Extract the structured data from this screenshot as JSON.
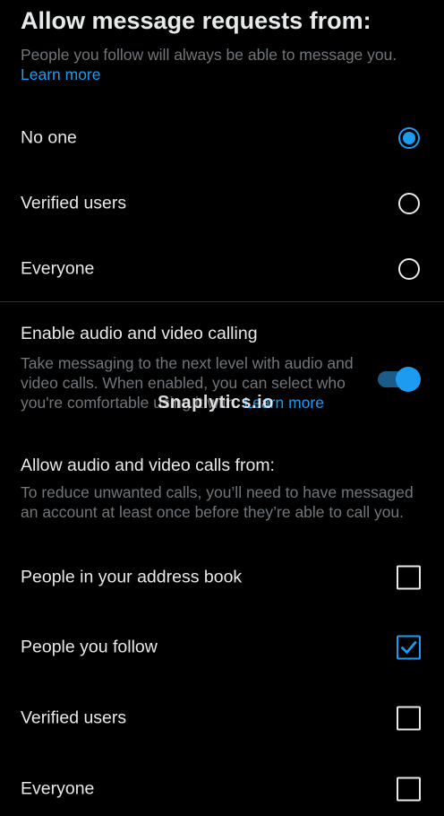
{
  "message_requests": {
    "title": "Allow message requests from:",
    "description": "People you follow will always be able to message you.",
    "learn_more": "Learn more",
    "options": [
      {
        "label": "No one",
        "selected": true
      },
      {
        "label": "Verified users",
        "selected": false
      },
      {
        "label": "Everyone",
        "selected": false
      }
    ]
  },
  "calling": {
    "title": "Enable audio and video calling",
    "description": "Take messaging to the next level with audio and video calls. When enabled, you can select who you're comfortable using it with.",
    "learn_more": "Learn more",
    "enabled": true
  },
  "calls_from": {
    "title": "Allow audio and video calls from:",
    "description": "To reduce unwanted calls, you’ll need to have messaged an account at least once before they’re able to call you.",
    "options": [
      {
        "label": "People in your address book",
        "checked": false
      },
      {
        "label": "People you follow",
        "checked": true
      },
      {
        "label": "Verified users",
        "checked": false
      },
      {
        "label": "Everyone",
        "checked": false
      }
    ]
  },
  "watermark": "Snaplytics.io",
  "colors": {
    "accent": "#1d9bf0",
    "background": "#000000",
    "text": "#e7e9ea",
    "secondary_text": "#71767b"
  }
}
